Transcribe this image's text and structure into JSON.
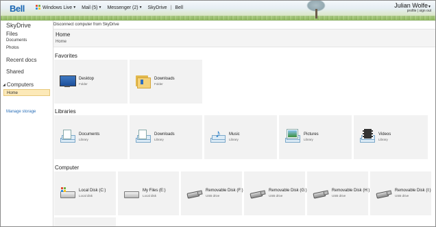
{
  "topbar": {
    "logo": "Bell",
    "nav": {
      "windows_live": "Windows Live",
      "mail": "Mail (5)",
      "messenger": "Messenger (2)",
      "skydrive": "SkyDrive",
      "bell": "Bell",
      "separator": "|"
    },
    "user": {
      "name": "Julian Wolfe",
      "links": "profile  |  sign out"
    }
  },
  "sidebar": {
    "title": "SkyDrive",
    "files": "Files",
    "documents": "Documents",
    "photos": "Photos",
    "recent_docs": "Recent docs",
    "shared": "Shared",
    "computers": "Computers",
    "home": "Home",
    "manage_storage": "Manage storage"
  },
  "main": {
    "disconnect": "Disconnect computer from SkyDrive",
    "page_title": "Home",
    "breadcrumb": "Home",
    "favorites": {
      "label": "Favorites",
      "items": [
        {
          "title": "Desktop",
          "sub": "Folder",
          "icon": "desktop-icon"
        },
        {
          "title": "Downloads",
          "sub": "Folder",
          "icon": "downloads-folder-icon"
        }
      ]
    },
    "libraries": {
      "label": "Libraries",
      "items": [
        {
          "title": "Documents",
          "sub": "Library",
          "icon": "documents-library-icon"
        },
        {
          "title": "Downloads",
          "sub": "Library",
          "icon": "downloads-library-icon"
        },
        {
          "title": "Music",
          "sub": "Library",
          "icon": "music-library-icon"
        },
        {
          "title": "Pictures",
          "sub": "Library",
          "icon": "pictures-library-icon"
        },
        {
          "title": "Videos",
          "sub": "Library",
          "icon": "videos-library-icon"
        }
      ]
    },
    "computer": {
      "label": "Computer",
      "items": [
        {
          "title": "Local Disk (C:)",
          "sub": "Local disk",
          "icon": "windows-drive-icon"
        },
        {
          "title": "My Files (E:)",
          "sub": "Local disk",
          "icon": "hard-disk-icon"
        },
        {
          "title": "Removable Disk (F:)",
          "sub": "USB drive",
          "icon": "usb-drive-icon"
        },
        {
          "title": "Removable Disk (G:)",
          "sub": "USB drive",
          "icon": "usb-drive-icon"
        },
        {
          "title": "Removable Disk (H:)",
          "sub": "USB drive",
          "icon": "usb-drive-icon"
        },
        {
          "title": "Removable Disk (I:)",
          "sub": "USB drive",
          "icon": "usb-drive-icon"
        }
      ]
    }
  },
  "colors": {
    "brand_blue": "#1a66b3",
    "selection": "#fce9b8",
    "tile_bg": "#f2f2f2",
    "link": "#2a6fb8"
  }
}
